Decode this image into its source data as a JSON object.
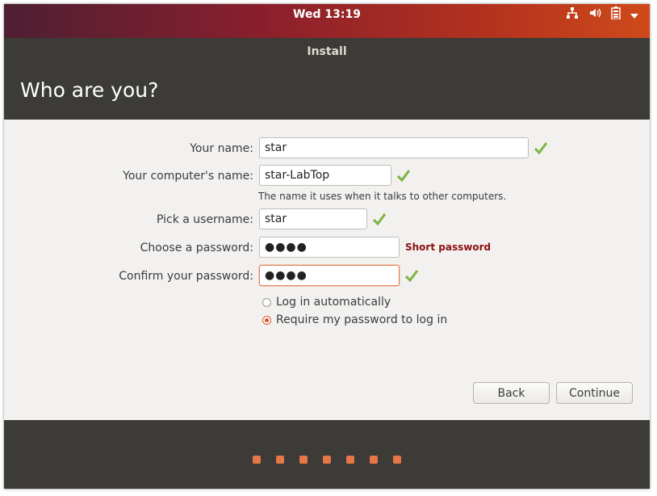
{
  "topbar": {
    "clock": "Wed 13:19",
    "icons": [
      "network-icon",
      "volume-icon",
      "battery-icon",
      "system-menu-arrow-icon"
    ]
  },
  "window": {
    "title": "Install"
  },
  "header": {
    "title": "Who are you?"
  },
  "form": {
    "name": {
      "label": "Your name:",
      "value": "star"
    },
    "computer": {
      "label": "Your computer's name:",
      "value": "star-LabTop",
      "hint": "The name it uses when it talks to other computers."
    },
    "username": {
      "label": "Pick a username:",
      "value": "star"
    },
    "password": {
      "label": "Choose a password:",
      "value": "●●●●",
      "strength": "Short password"
    },
    "confirm": {
      "label": "Confirm your password:",
      "value": "●●●●"
    }
  },
  "login_options": {
    "auto": {
      "label": "Log in automatically",
      "selected": false
    },
    "require": {
      "label": "Require my password to log in",
      "selected": true
    }
  },
  "buttons": {
    "back": "Back",
    "continue": "Continue"
  },
  "progress": {
    "steps": 7
  },
  "colors": {
    "accent": "#e57645",
    "check": "#7cb342",
    "warning": "#8b1010"
  }
}
